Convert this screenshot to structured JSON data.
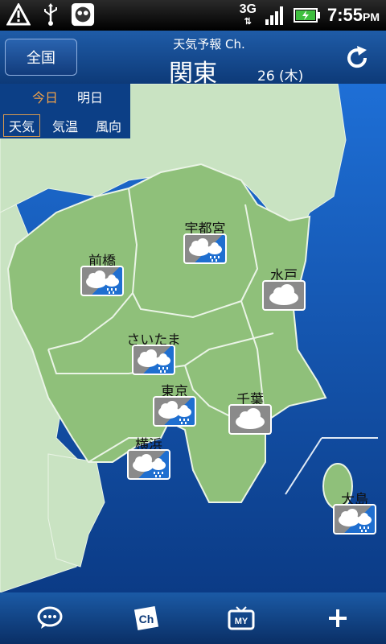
{
  "status_bar": {
    "network": "3G",
    "time": "7:55",
    "ampm": "PM",
    "icons": [
      "warning-icon",
      "usb-icon",
      "app-notification-icon",
      "signal-icon",
      "battery-charging-icon"
    ]
  },
  "header": {
    "zenkoku_label": "全国",
    "channel_title": "天気予報 Ch.",
    "region_title": "関東",
    "date": "26 (木)"
  },
  "tabs": {
    "day": [
      "今日",
      "明日"
    ],
    "type": [
      "天気",
      "気温",
      "風向"
    ],
    "active_day": "今日",
    "active_type": "天気"
  },
  "markers": [
    {
      "name": "宇都宮",
      "weather": "cloudy-then-rain"
    },
    {
      "name": "前橋",
      "weather": "cloudy-then-rain"
    },
    {
      "name": "水戸",
      "weather": "cloudy"
    },
    {
      "name": "さいたま",
      "weather": "cloudy-then-rain"
    },
    {
      "name": "東京",
      "weather": "cloudy-then-rain"
    },
    {
      "name": "千葉",
      "weather": "cloudy"
    },
    {
      "name": "横浜",
      "weather": "cloudy-then-rain"
    },
    {
      "name": "大島",
      "weather": "cloudy-then-rain"
    }
  ],
  "bottom_bar": {
    "buttons": [
      "chat-icon",
      "channel-icon",
      "my-tv-icon",
      "plus-icon"
    ],
    "channel_glyph": "Ch",
    "my_glyph": "MY"
  },
  "colors": {
    "sea": "#1a5fbf",
    "land": "#8fc07a",
    "land_light": "#c9e3c2",
    "accent_tab": "#f0a24a"
  }
}
